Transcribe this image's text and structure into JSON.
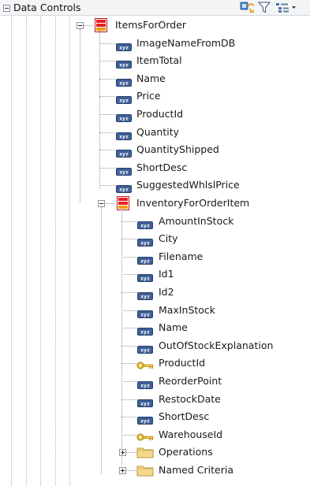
{
  "panel": {
    "title": "Data Controls",
    "toolbar_icons": [
      "refresh-icon",
      "filter-icon",
      "tree-options-icon"
    ]
  },
  "tree": {
    "items_for_order": {
      "label": "ItemsForOrder",
      "icon": "collection-icon",
      "attributes": [
        "ImageNameFromDB",
        "ItemTotal",
        "Name",
        "Price",
        "ProductId",
        "Quantity",
        "QuantityShipped",
        "ShortDesc",
        "SuggestedWhlslPrice"
      ],
      "attribute_icon": "attribute-icon"
    },
    "inventory_for_order_item": {
      "label": "InventoryForOrderItem",
      "icon": "collection-icon",
      "attributes": [
        {
          "label": "AmountInStock",
          "icon": "attribute-icon"
        },
        {
          "label": "City",
          "icon": "attribute-icon"
        },
        {
          "label": "Filename",
          "icon": "attribute-icon"
        },
        {
          "label": "Id1",
          "icon": "attribute-icon"
        },
        {
          "label": "Id2",
          "icon": "attribute-icon"
        },
        {
          "label": "MaxInStock",
          "icon": "attribute-icon"
        },
        {
          "label": "Name",
          "icon": "attribute-icon"
        },
        {
          "label": "OutOfStockExplanation",
          "icon": "attribute-icon"
        },
        {
          "label": "ProductId",
          "icon": "key-icon"
        },
        {
          "label": "ReorderPoint",
          "icon": "attribute-icon"
        },
        {
          "label": "RestockDate",
          "icon": "attribute-icon"
        },
        {
          "label": "ShortDesc",
          "icon": "attribute-icon"
        },
        {
          "label": "WarehouseId",
          "icon": "key-icon"
        }
      ],
      "folders": [
        {
          "label": "Operations",
          "icon": "folder-icon"
        },
        {
          "label": "Named Criteria",
          "icon": "folder-icon"
        }
      ]
    }
  }
}
